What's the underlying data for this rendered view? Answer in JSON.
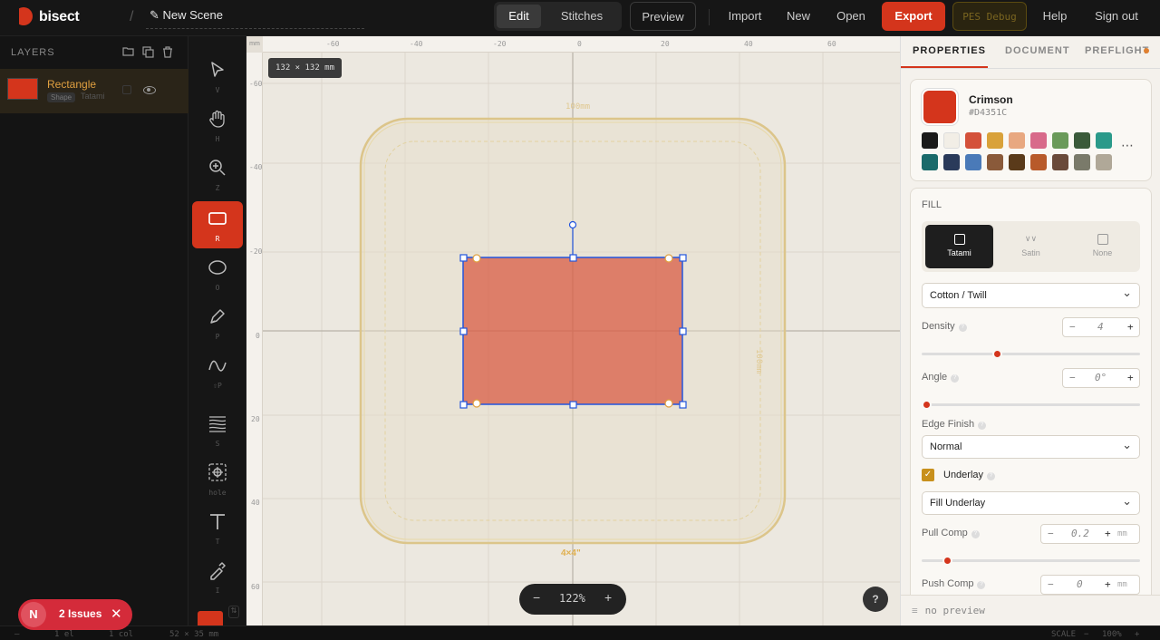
{
  "app": {
    "brand": "bisect",
    "separator": "/",
    "scene_name": "✎ New Scene"
  },
  "topbar": {
    "modes": [
      {
        "label": "Edit",
        "active": true
      },
      {
        "label": "Stitches",
        "active": false
      }
    ],
    "preview": "Preview",
    "import": "Import",
    "new": "New",
    "open": "Open",
    "export": "Export",
    "pes_debug": "PES Debug",
    "help": "Help",
    "sign_out": "Sign out"
  },
  "layers": {
    "title": "LAYERS",
    "items": [
      {
        "name": "Rectangle",
        "type": "Shape",
        "fill": "Tatami",
        "color": "#D4351C"
      }
    ]
  },
  "tools": [
    {
      "name": "select",
      "key": "V"
    },
    {
      "name": "pan",
      "key": "H"
    },
    {
      "name": "zoom",
      "key": "Z"
    },
    {
      "name": "rectangle",
      "key": "R",
      "active": true
    },
    {
      "name": "ellipse",
      "key": "O"
    },
    {
      "name": "pen",
      "key": "P"
    },
    {
      "name": "curve",
      "key": "⇧P"
    },
    {
      "name": "satin",
      "key": "S"
    },
    {
      "name": "hole",
      "key": "hole"
    },
    {
      "name": "text",
      "key": "T"
    },
    {
      "name": "eyedropper",
      "key": "I"
    }
  ],
  "canvas": {
    "size_chip": "132 × 132 mm",
    "ruler_x": [
      "-60",
      "-40",
      "-20",
      "0",
      "20",
      "40",
      "60"
    ],
    "ruler_y": [
      "-60",
      "-40",
      "-20",
      "0",
      "20",
      "40",
      "60"
    ],
    "hoop_top_label": "100mm",
    "hoop_side_label": "100mm",
    "hoop_bottom_label": "4×4\"",
    "zoom": "122%",
    "help": "?"
  },
  "properties": {
    "tabs": [
      {
        "label": "PROPERTIES",
        "active": true
      },
      {
        "label": "DOCUMENT",
        "active": false
      },
      {
        "label": "PREFLIGHT",
        "active": false
      }
    ],
    "color_name": "Crimson",
    "color_hex": "#D4351C",
    "palette": [
      "#1a1a1a",
      "#f2eee6",
      "#d4513a",
      "#d9a23a",
      "#e8a880",
      "#d86a8a",
      "#6a9a5a",
      "#3a5a3a",
      "#2a9a8a",
      "#1a6a6a",
      "#2a3a5a",
      "#4a7ab8",
      "#8a5a3a",
      "#5a3a1a",
      "#b85a2a",
      "#6a4a3a",
      "#7a7a6a",
      "#b0a898"
    ],
    "more": "⋯",
    "fill_label": "FILL",
    "fill_types": [
      {
        "label": "Tatami",
        "active": true
      },
      {
        "label": "Satin",
        "active": false
      },
      {
        "label": "None",
        "active": false
      }
    ],
    "fabric": "Cotton / Twill",
    "density_label": "Density",
    "density_value": "4",
    "density_fraction": 0.34,
    "angle_label": "Angle",
    "angle_value": "0°",
    "angle_fraction": 0.0,
    "edge_finish_label": "Edge Finish",
    "edge_finish": "Normal",
    "underlay_label": "Underlay",
    "underlay_checked": true,
    "underlay_type": "Fill Underlay",
    "pull_comp_label": "Pull Comp",
    "pull_comp_value": "0.2",
    "pull_comp_fraction": 0.1,
    "push_comp_label": "Push Comp",
    "push_comp_value": "0",
    "unit": "mm",
    "minus": "−",
    "plus": "+",
    "no_preview": "no preview"
  },
  "status": {
    "elements": "1 el",
    "cols": "1 col",
    "dims": "52 × 35 mm",
    "scale_label": "SCALE",
    "scale": "100%"
  },
  "issues": {
    "count_label": "2 Issues",
    "avatar": "N"
  }
}
